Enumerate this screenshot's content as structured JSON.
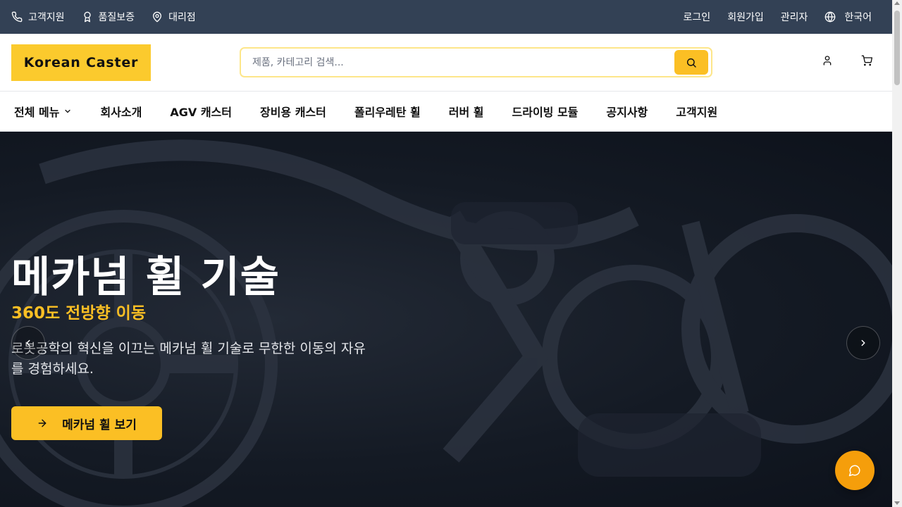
{
  "topbar": {
    "left": [
      {
        "label": "고객지원",
        "icon": "phone-icon"
      },
      {
        "label": "품질보증",
        "icon": "award-icon"
      },
      {
        "label": "대리점",
        "icon": "map-pin-icon"
      }
    ],
    "right": [
      "로그인",
      "회원가입",
      "관리자"
    ],
    "language": "한국어"
  },
  "header": {
    "logo": "Korean Caster",
    "search_placeholder": "제품, 카테고리 검색..."
  },
  "nav": {
    "all_menu": "전체 메뉴",
    "items": [
      "회사소개",
      "AGV 캐스터",
      "장비용 캐스터",
      "폴리우레탄 휠",
      "러버 휠",
      "드라이빙 모듈",
      "공지사항",
      "고객지원"
    ]
  },
  "hero": {
    "title": "메카넘 휠 기술",
    "subtitle": "360도 전방향 이동",
    "description": "로봇공학의 혁신을 이끄는 메카넘 휠 기술로 무한한 이동의 자유를 경험하세요.",
    "cta": "메카넘 휠 보기"
  },
  "colors": {
    "topbar": "#334155",
    "accent": "#fbbf24",
    "logo_bg": "#fbca2d",
    "chat_button": "#f59e0b"
  }
}
